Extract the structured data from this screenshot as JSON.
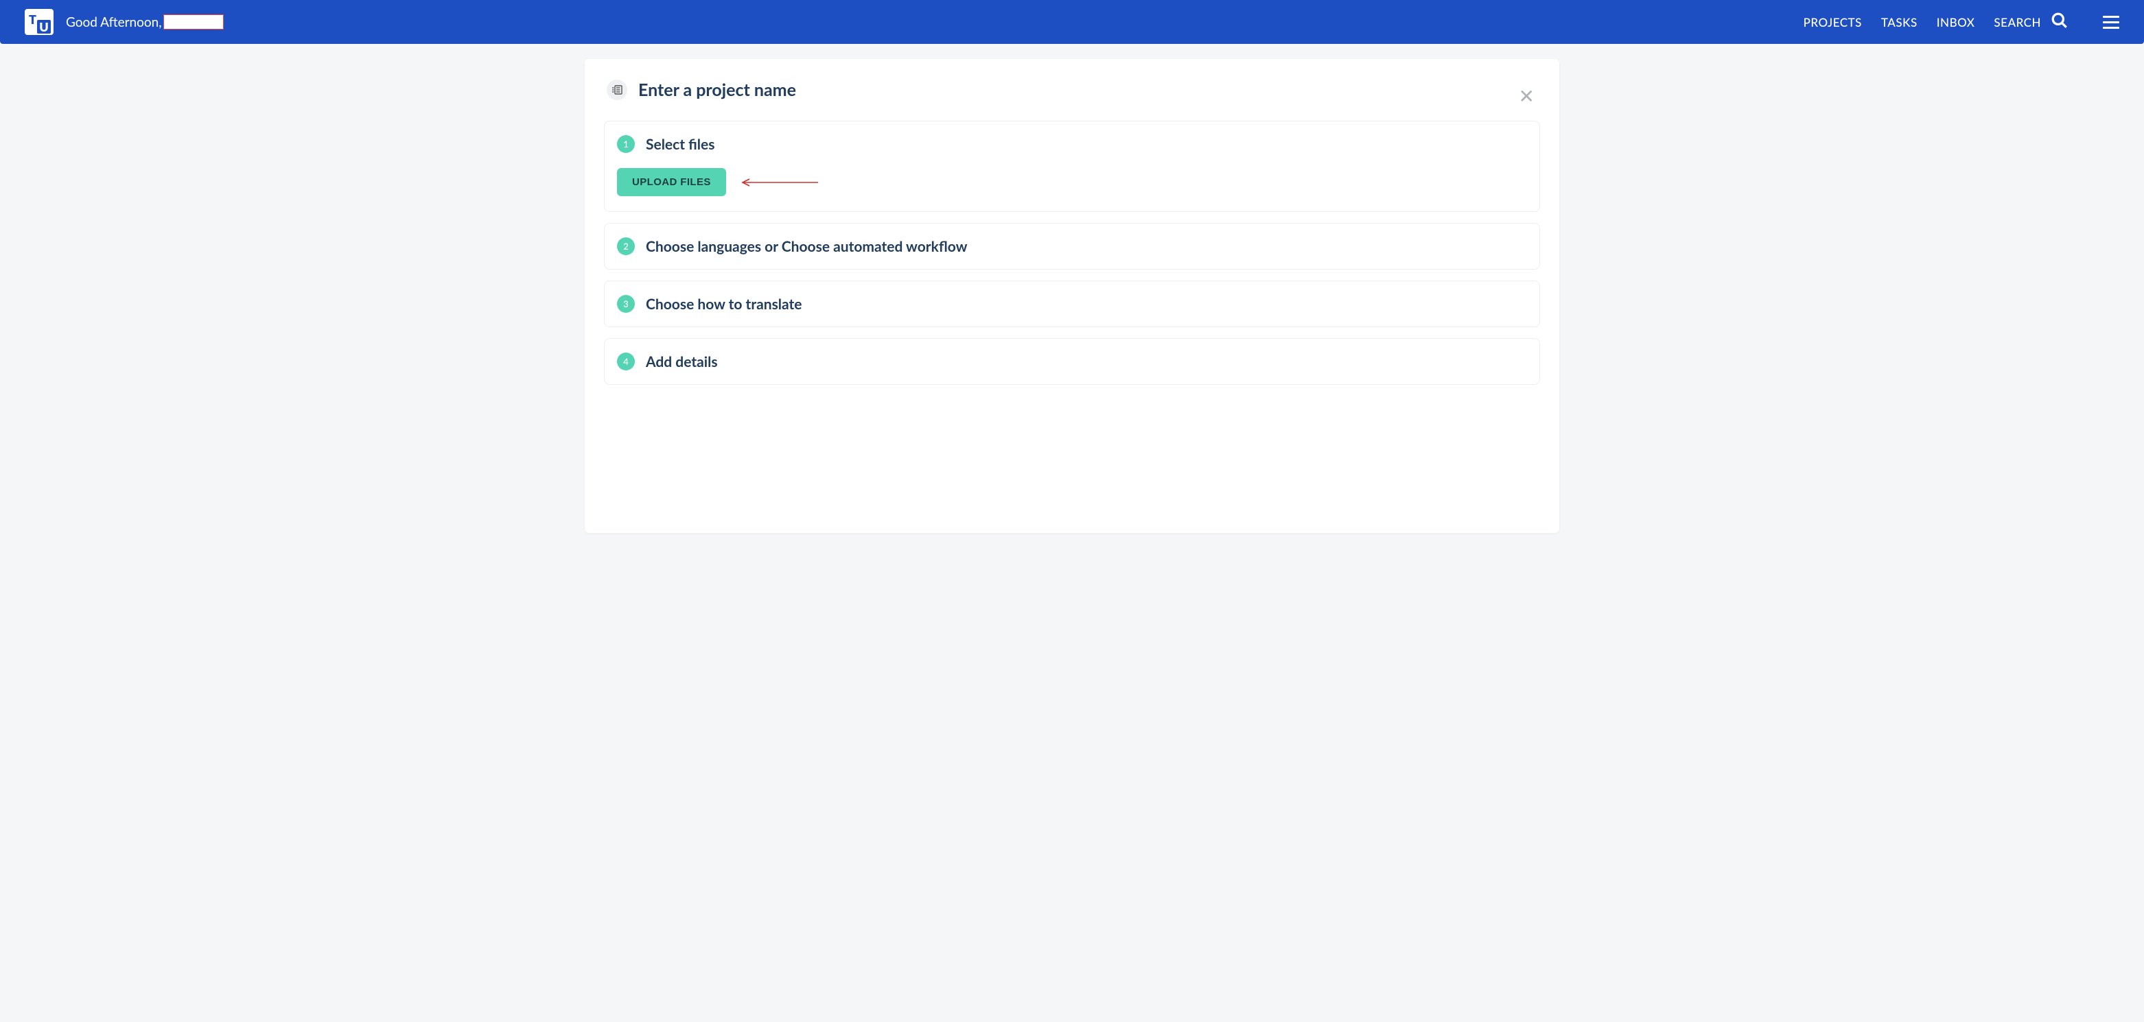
{
  "header": {
    "greeting": "Good Afternoon,",
    "nav": {
      "projects": "PROJECTS",
      "tasks": "TASKS",
      "inbox": "INBOX",
      "search": "SEARCH"
    }
  },
  "main": {
    "title_placeholder": "Enter a project name",
    "steps": [
      {
        "num": "1",
        "title": "Select files",
        "upload_label": "UPLOAD FILES"
      },
      {
        "num": "2",
        "title": "Choose languages or Choose automated workflow"
      },
      {
        "num": "3",
        "title": "Choose how to translate"
      },
      {
        "num": "4",
        "title": "Add details"
      }
    ]
  }
}
